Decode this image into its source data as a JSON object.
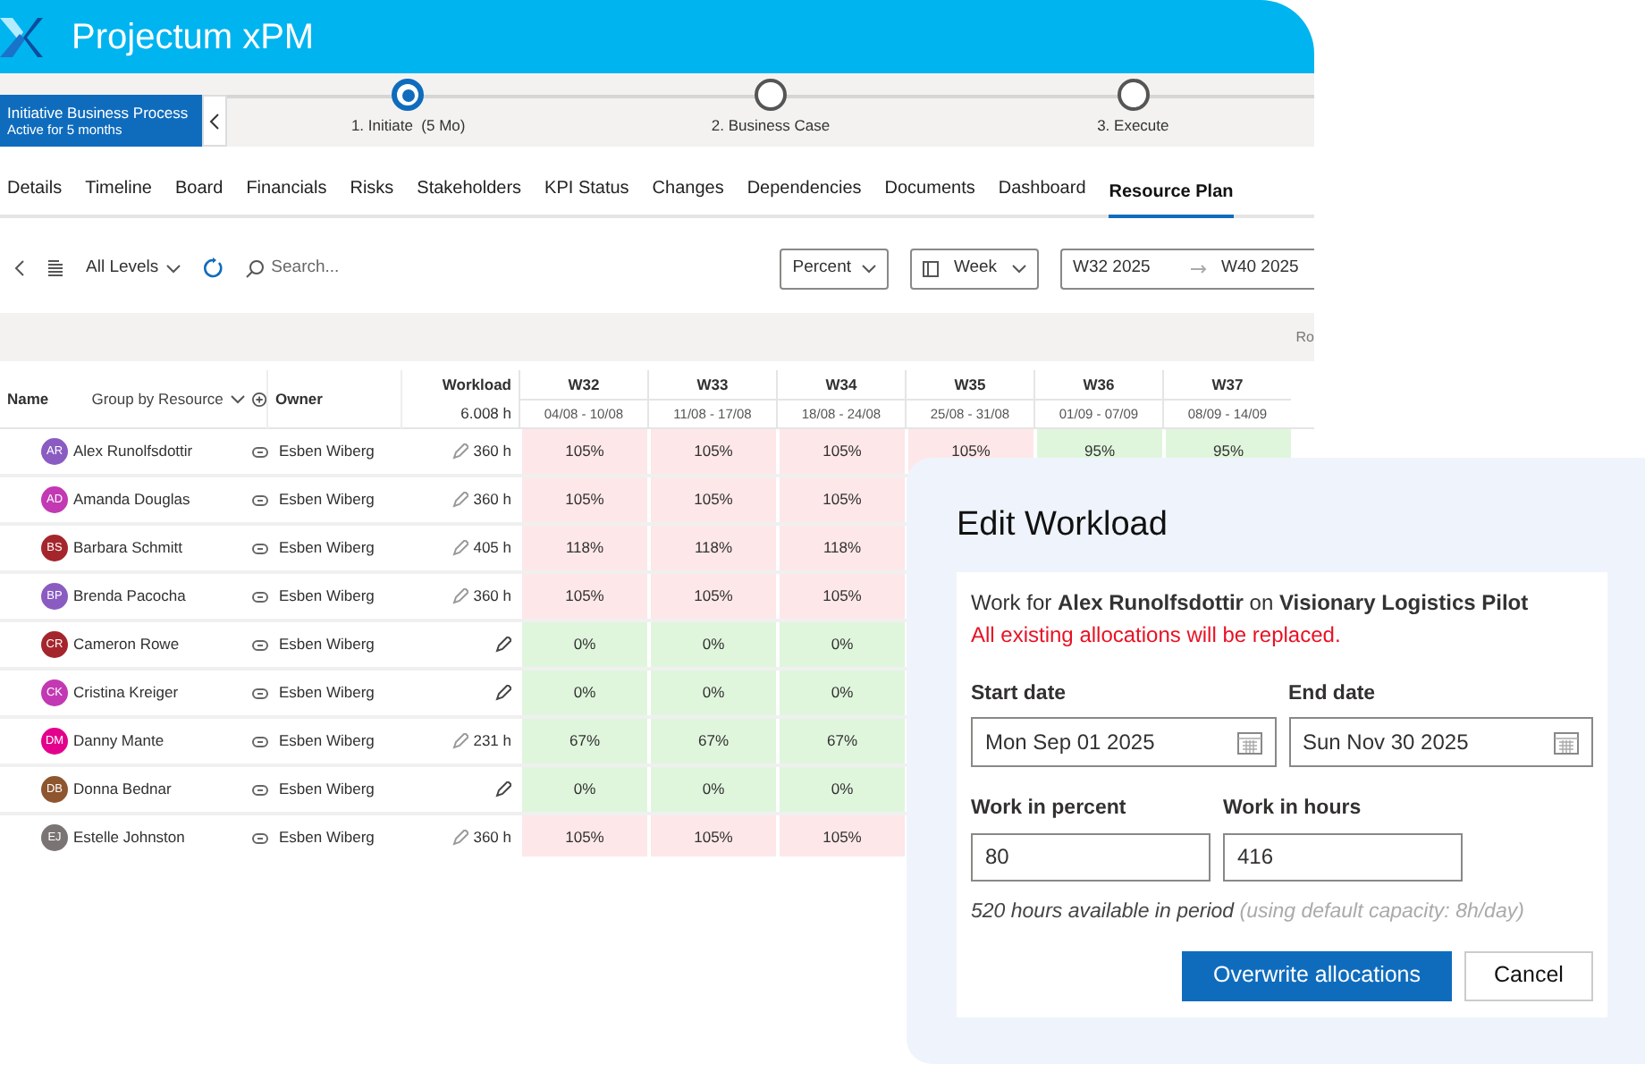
{
  "app": {
    "title": "Projectum xPM"
  },
  "process": {
    "name": "Initiative Business Process",
    "subtitle": "Active for 5 months",
    "stages": [
      {
        "label": "1. Initiate  (5 Mo)",
        "selected": true
      },
      {
        "label": "2. Business Case",
        "selected": false
      },
      {
        "label": "3. Execute",
        "selected": false
      }
    ]
  },
  "tabs": [
    {
      "label": "Details",
      "selected": false
    },
    {
      "label": "Timeline",
      "selected": false
    },
    {
      "label": "Board",
      "selected": false
    },
    {
      "label": "Financials",
      "selected": false
    },
    {
      "label": "Risks",
      "selected": false
    },
    {
      "label": "Stakeholders",
      "selected": false
    },
    {
      "label": "KPI Status",
      "selected": false
    },
    {
      "label": "Changes",
      "selected": false
    },
    {
      "label": "Dependencies",
      "selected": false
    },
    {
      "label": "Documents",
      "selected": false
    },
    {
      "label": "Dashboard",
      "selected": false
    },
    {
      "label": "Resource Plan",
      "selected": true
    }
  ],
  "toolbar": {
    "levels": "All Levels",
    "search_placeholder": "Search...",
    "unit": "Percent",
    "scale": "Week",
    "range_start": "W32 2025",
    "range_end": "W40 2025",
    "band_text": "Ro"
  },
  "table": {
    "columns": {
      "name": "Name",
      "group": "Group by Resource",
      "owner": "Owner",
      "workload": "Workload",
      "workload_total": "6.008 h"
    },
    "weeks": [
      {
        "label": "W32",
        "dates": "04/08 - 10/08"
      },
      {
        "label": "W33",
        "dates": "11/08 - 17/08"
      },
      {
        "label": "W34",
        "dates": "18/08 - 24/08"
      },
      {
        "label": "W35",
        "dates": "25/08 - 31/08"
      },
      {
        "label": "W36",
        "dates": "01/09 - 07/09"
      },
      {
        "label": "W37",
        "dates": "08/09 - 14/09"
      }
    ],
    "rows": [
      {
        "initials": "AR",
        "color": "#8a5cc2",
        "name": "Alex Runolfsdottir",
        "owner": "Esben Wiberg",
        "workload": "360 h",
        "cells": [
          {
            "text": "105%",
            "over": true
          },
          {
            "text": "105%",
            "over": true
          },
          {
            "text": "105%",
            "over": true
          },
          {
            "text": "105%",
            "over": true
          },
          {
            "text": "95%",
            "over": false
          },
          {
            "text": "95%",
            "over": false
          }
        ]
      },
      {
        "initials": "AD",
        "color": "#c239b3",
        "name": "Amanda Douglas",
        "owner": "Esben Wiberg",
        "workload": "360 h",
        "cells": [
          {
            "text": "105%",
            "over": true
          },
          {
            "text": "105%",
            "over": true
          },
          {
            "text": "105%",
            "over": true
          }
        ]
      },
      {
        "initials": "BS",
        "color": "#a4262c",
        "name": "Barbara Schmitt",
        "owner": "Esben Wiberg",
        "workload": "405 h",
        "cells": [
          {
            "text": "118%",
            "over": true
          },
          {
            "text": "118%",
            "over": true
          },
          {
            "text": "118%",
            "over": true
          }
        ]
      },
      {
        "initials": "BP",
        "color": "#8a5cc2",
        "name": "Brenda Pacocha",
        "owner": "Esben Wiberg",
        "workload": "360 h",
        "cells": [
          {
            "text": "105%",
            "over": true
          },
          {
            "text": "105%",
            "over": true
          },
          {
            "text": "105%",
            "over": true
          }
        ]
      },
      {
        "initials": "CR",
        "color": "#a4262c",
        "name": "Cameron Rowe",
        "owner": "Esben Wiberg",
        "cells": [
          {
            "text": "0%",
            "over": false
          },
          {
            "text": "0%",
            "over": false
          },
          {
            "text": "0%",
            "over": false
          }
        ]
      },
      {
        "initials": "CK",
        "color": "#c239b3",
        "name": "Cristina Kreiger",
        "owner": "Esben Wiberg",
        "cells": [
          {
            "text": "0%",
            "over": false
          },
          {
            "text": "0%",
            "over": false
          },
          {
            "text": "0%",
            "over": false
          }
        ]
      },
      {
        "initials": "DM",
        "color": "#e3008c",
        "name": "Danny Mante",
        "owner": "Esben Wiberg",
        "workload": "231 h",
        "cells": [
          {
            "text": "67%",
            "over": false
          },
          {
            "text": "67%",
            "over": false
          },
          {
            "text": "67%",
            "over": false
          }
        ]
      },
      {
        "initials": "DB",
        "color": "#8e562e",
        "name": "Donna Bednar",
        "owner": "Esben Wiberg",
        "cells": [
          {
            "text": "0%",
            "over": false
          },
          {
            "text": "0%",
            "over": false
          },
          {
            "text": "0%",
            "over": false
          }
        ]
      },
      {
        "initials": "EJ",
        "color": "#7a7574",
        "name": "Estelle Johnston",
        "owner": "Esben Wiberg",
        "workload": "360 h",
        "cells": [
          {
            "text": "105%",
            "over": true
          },
          {
            "text": "105%",
            "over": true
          },
          {
            "text": "105%",
            "over": true
          }
        ]
      }
    ]
  },
  "dialog": {
    "title": "Edit Workload",
    "intro": "Work for **Alex Runolfsdottir** on **Visionary Logistics Pilot**",
    "warning": "All existing allocations will be replaced.",
    "start_label": "Start date",
    "start_value": "Mon Sep 01 2025",
    "end_label": "End date",
    "end_value": "Sun Nov 30 2025",
    "percent_label": "Work in percent",
    "percent_value": "80",
    "hours_label": "Work in hours",
    "hours_value": "416",
    "note": "520 hours available in period",
    "note_hint": "(using default capacity: 8h/day)",
    "buttons": [
      {
        "label": "Overwrite allocations",
        "kind": "primary"
      },
      {
        "label": "Cancel",
        "kind": "secondary"
      }
    ]
  }
}
